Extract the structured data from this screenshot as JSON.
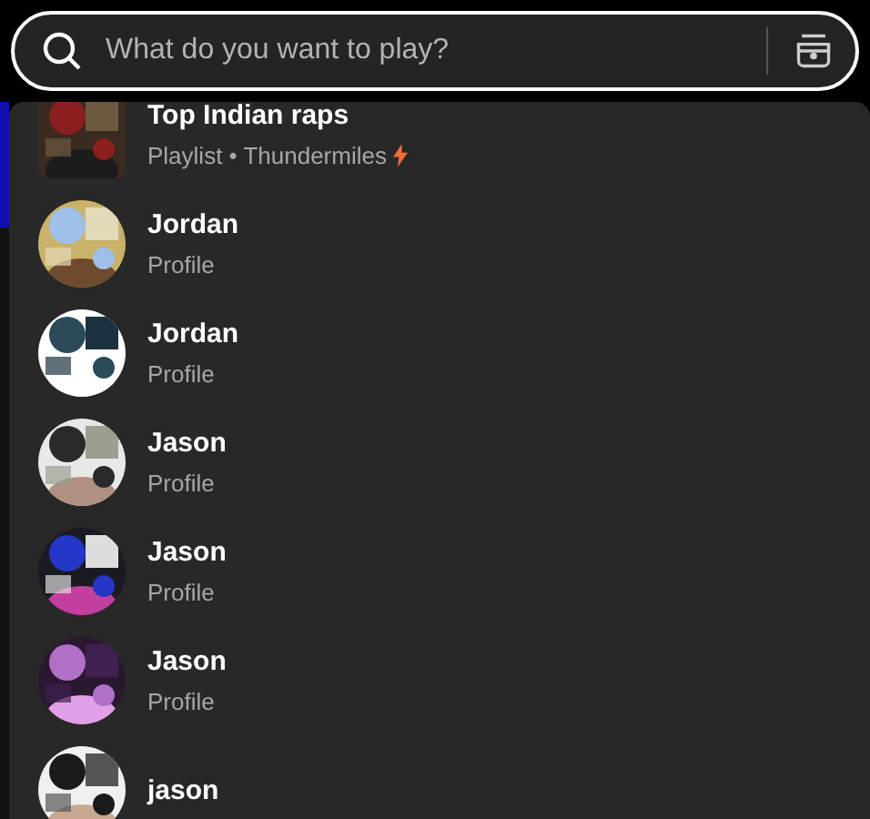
{
  "search": {
    "placeholder": "What do you want to play?"
  },
  "results": [
    {
      "kind": "playlist",
      "title": "Top Indian raps",
      "subtitle": "Playlist • Thundermiles",
      "verified": true
    },
    {
      "kind": "profile",
      "title": "Jordan",
      "type": "Profile"
    },
    {
      "kind": "profile",
      "title": "Jordan",
      "type": "Profile"
    },
    {
      "kind": "profile",
      "title": "Jason",
      "type": "Profile"
    },
    {
      "kind": "profile",
      "title": "Jason",
      "type": "Profile"
    },
    {
      "kind": "profile",
      "title": "Jason",
      "type": "Profile"
    },
    {
      "kind": "profile",
      "title": "jason"
    }
  ]
}
